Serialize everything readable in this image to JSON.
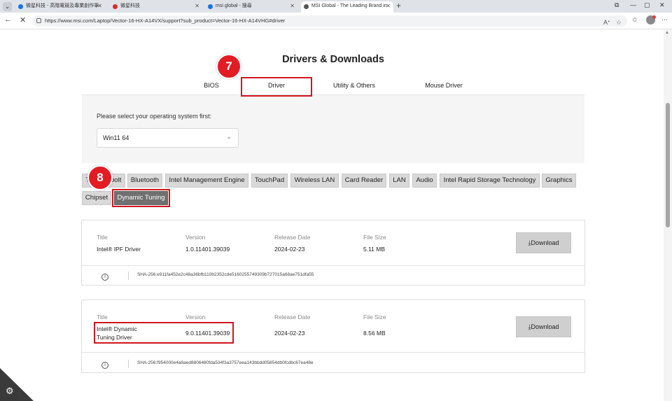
{
  "browser": {
    "tabs": [
      {
        "title": "微星科技 - 高階電競及專業創作筆",
        "favicon_color": "#1a73e8"
      },
      {
        "title": "微星科技",
        "favicon_color": "#d32f2f"
      },
      {
        "title": "msi global - 搜尋",
        "favicon_color": "#1a73e8"
      },
      {
        "title": "MSI Global - The Leading Brand in",
        "favicon_color": "#555555"
      }
    ],
    "new_tab": "+",
    "window_controls": [
      "⧉",
      "—",
      "▢",
      "✕"
    ],
    "url": "https://www.msi.com/Laptop/Vector-16-HX-A14VX/support?sub_product=Vector-16-HX-A14VHG#driver"
  },
  "page": {
    "heading": "Drivers & Downloads",
    "tabs": [
      "BIOS",
      "Driver",
      "Utility & Others",
      "Mouse Driver"
    ],
    "os_label": "Please select your operating system first:",
    "os_value": "Win11 64",
    "categories_row1": [
      "Thunderbolt",
      "Bluetooth",
      "Intel Management Engine",
      "TouchPad",
      "Wireless LAN",
      "Card Reader",
      "LAN",
      "Audio",
      "Intel Rapid Storage Technology",
      "Graphics"
    ],
    "categories_row2": [
      "Chipset",
      "Dynamic Tuning"
    ],
    "columns": {
      "title": "Title",
      "version": "Version",
      "release_date": "Release Date",
      "file_size": "File Size"
    },
    "drivers": [
      {
        "title_line1": "Intel® IPF Driver",
        "title_line2": "",
        "version": "1.0.11401.39039",
        "release_date": "2024-02-23",
        "file_size": "5.11 MB",
        "download": "⤓Download",
        "sha": "SHA-256:e911fa452e2c48a36bfb110b2352cde5160255749309b727015a68ae751dfa55"
      },
      {
        "title_line1": "Intel® Dynamic",
        "title_line2": "Tuning Driver",
        "version": "9.0.11401.39039",
        "release_date": "2024-02-23",
        "file_size": "8.56 MB",
        "download": "⤓Download",
        "sha": "SHA-256:f954000e4a8aed8806480fda534f3a3757eea143bbdd05854db0fcdbc67ea48e"
      }
    ]
  },
  "annotations": {
    "step1": "7",
    "step2": "8",
    "accent_color": "#e31b23"
  }
}
